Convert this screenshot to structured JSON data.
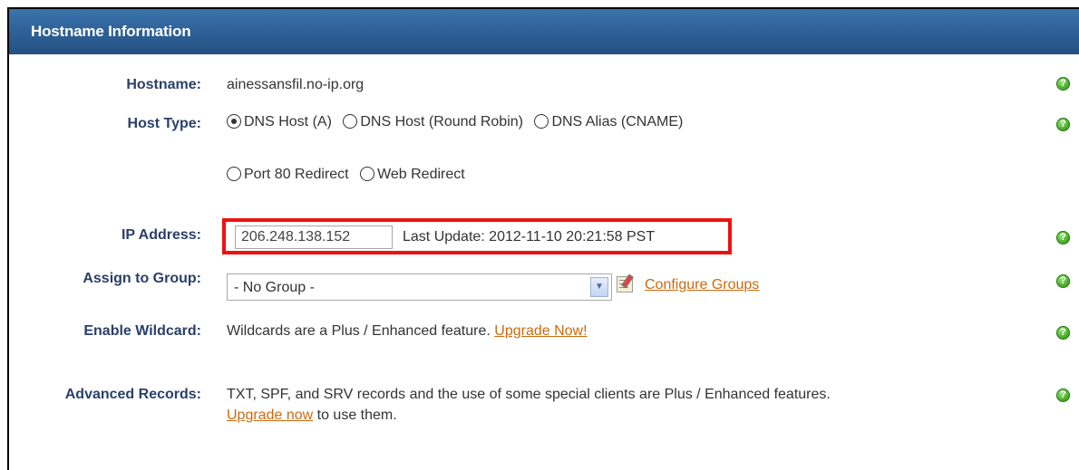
{
  "section": {
    "title": "Hostname Information"
  },
  "hostname": {
    "label": "Hostname:",
    "value": "ainessansfil.no-ip.org"
  },
  "host_type": {
    "label": "Host Type:",
    "options": [
      {
        "label": "DNS Host (A)",
        "checked": true
      },
      {
        "label": "DNS Host (Round Robin)",
        "checked": false
      },
      {
        "label": "DNS Alias (CNAME)",
        "checked": false
      },
      {
        "label": "Port 80 Redirect",
        "checked": false
      },
      {
        "label": "Web Redirect",
        "checked": false
      }
    ]
  },
  "ip_address": {
    "label": "IP Address:",
    "value": "206.248.138.152",
    "last_update": "Last Update: 2012-11-10 20:21:58 PST",
    "highlight_color": "#ee1111"
  },
  "group": {
    "label": "Assign to Group:",
    "selected": "- No Group -",
    "configure_link": "Configure Groups"
  },
  "wildcard": {
    "label": "Enable Wildcard:",
    "text": "Wildcards are a Plus / Enhanced feature.",
    "link": "Upgrade Now!"
  },
  "advanced": {
    "label": "Advanced Records:",
    "text": "TXT, SPF, and SRV records and the use of some special clients are Plus / Enhanced features.",
    "link": "Upgrade now",
    "suffix": "to use them."
  },
  "help_icon_glyph": "?",
  "colors": {
    "header": "#2d5f95",
    "label": "#2a3f6a",
    "link": "#cc6a10",
    "help": "#4aae2b"
  }
}
